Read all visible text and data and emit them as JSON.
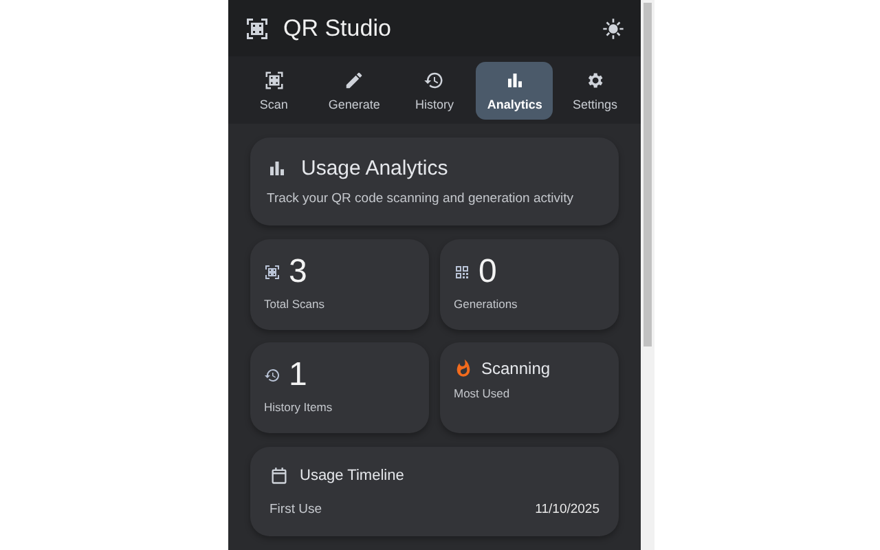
{
  "app": {
    "title": "QR Studio"
  },
  "tabs": [
    {
      "label": "Scan",
      "selected": false
    },
    {
      "label": "Generate",
      "selected": false
    },
    {
      "label": "History",
      "selected": false
    },
    {
      "label": "Analytics",
      "selected": true
    },
    {
      "label": "Settings",
      "selected": false
    }
  ],
  "overview": {
    "title": "Usage Analytics",
    "subtitle": "Track your QR code scanning and generation activity"
  },
  "stats": [
    {
      "kind": "count",
      "value": "3",
      "label": "Total Scans"
    },
    {
      "kind": "count",
      "value": "0",
      "label": "Generations"
    },
    {
      "kind": "count",
      "value": "1",
      "label": "History Items"
    },
    {
      "kind": "text",
      "value": "Scanning",
      "label": "Most Used"
    }
  ],
  "timeline": {
    "title": "Usage Timeline",
    "rows": [
      {
        "label": "First Use",
        "value": "11/10/2025"
      }
    ]
  }
}
